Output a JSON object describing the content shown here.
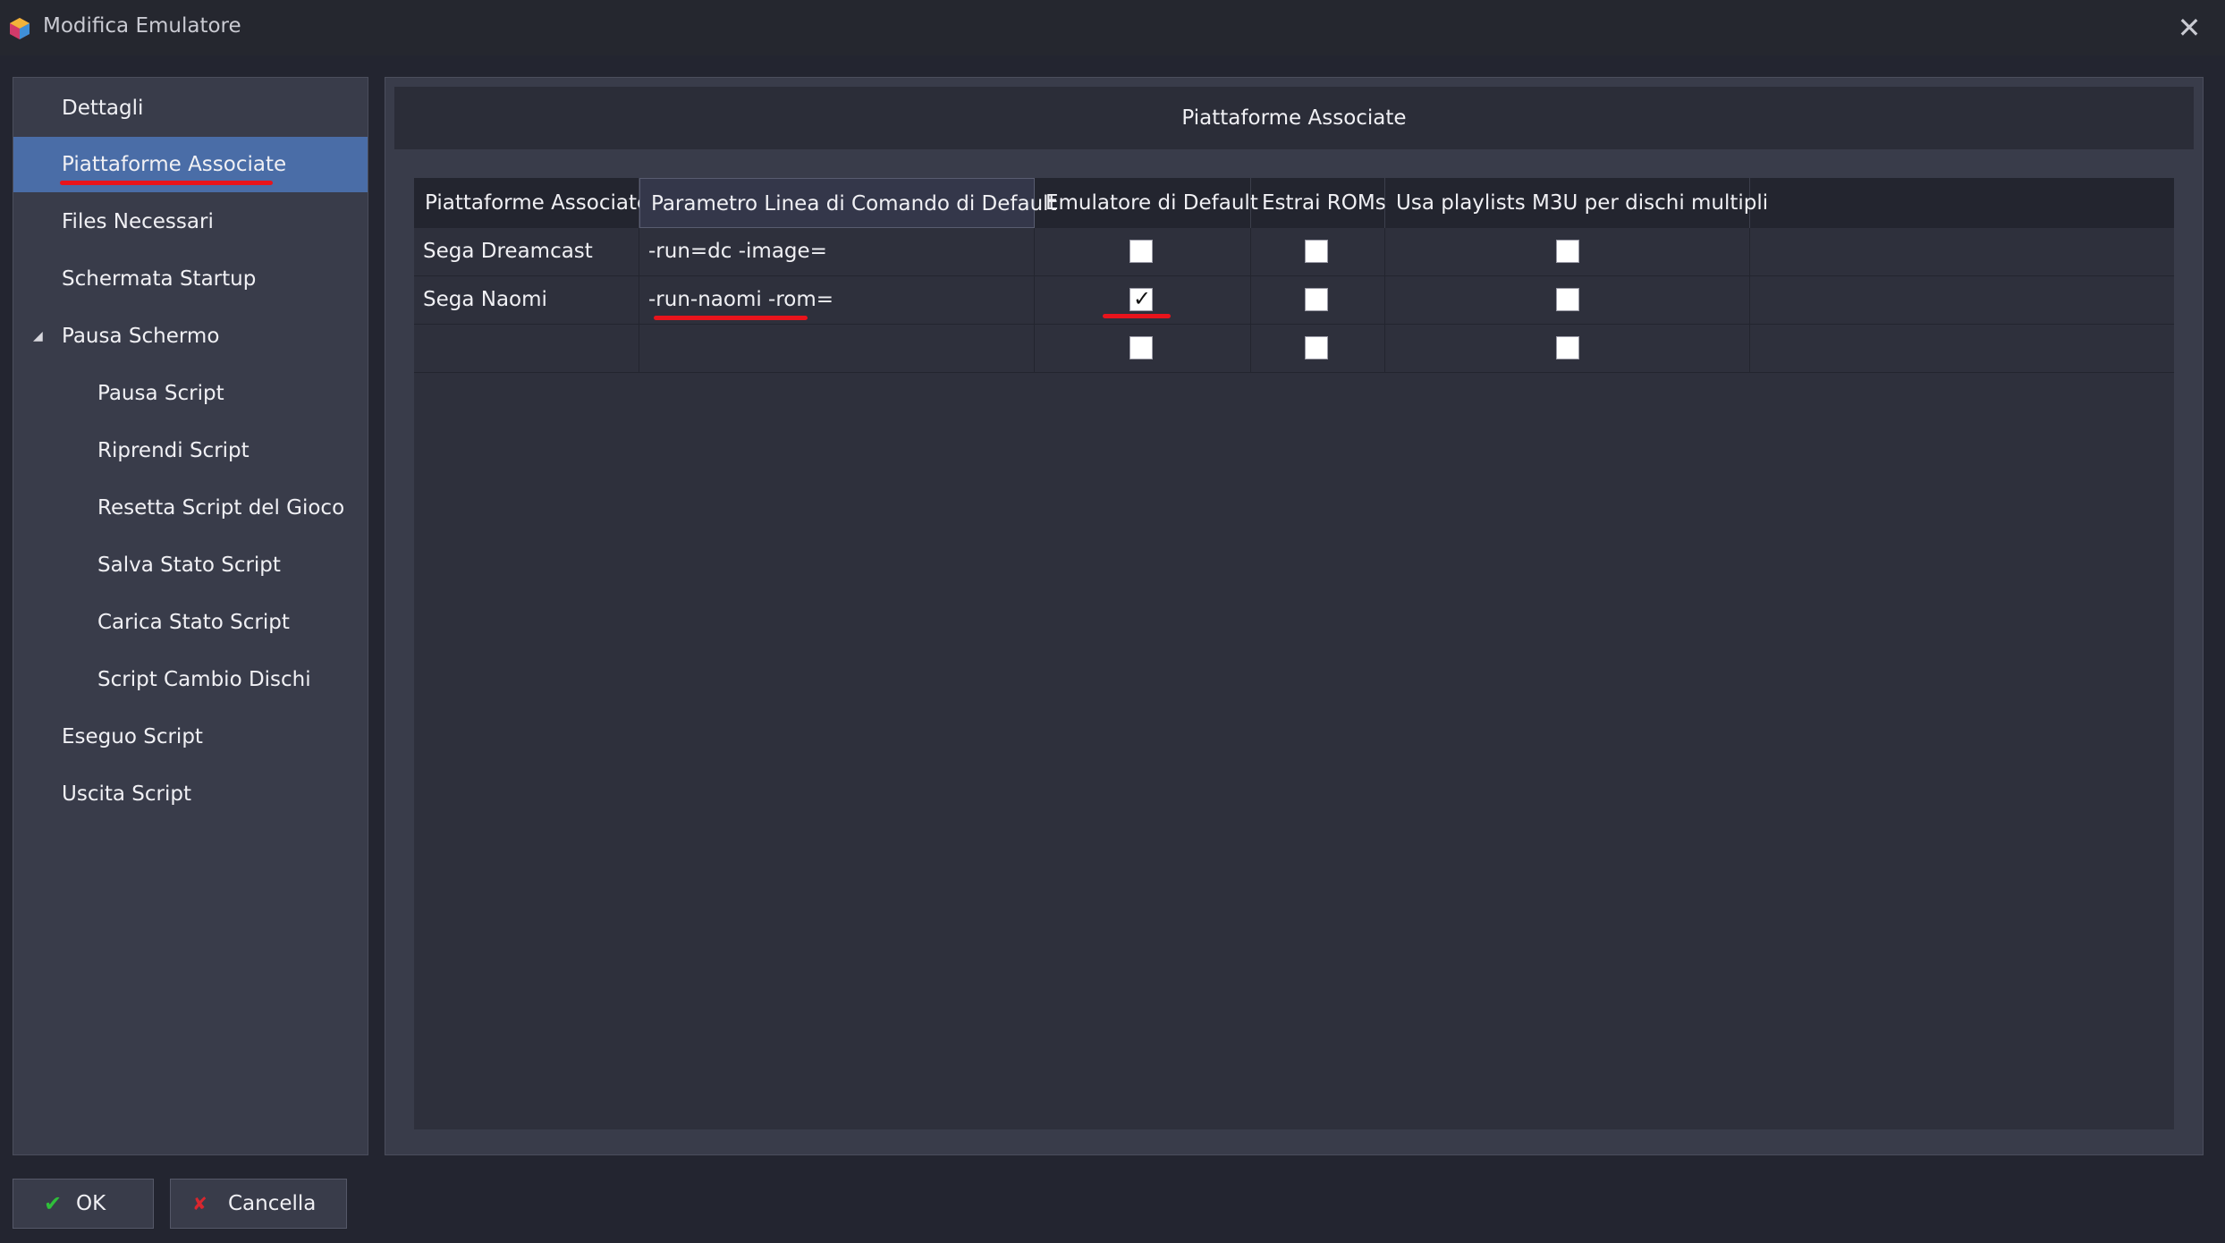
{
  "window": {
    "title": "Modifica Emulatore",
    "close_icon": "close-icon"
  },
  "sidebar": {
    "items": [
      {
        "label": "Dettagli"
      },
      {
        "label": "Piattaforme Associate"
      },
      {
        "label": "Files Necessari"
      },
      {
        "label": "Schermata Startup"
      },
      {
        "label": "Pausa Schermo"
      },
      {
        "label": "Pausa Script"
      },
      {
        "label": "Riprendi Script"
      },
      {
        "label": "Resetta Script del Gioco"
      },
      {
        "label": "Salva Stato Script"
      },
      {
        "label": "Carica Stato Script"
      },
      {
        "label": "Script Cambio Dischi"
      },
      {
        "label": "Eseguo Script"
      },
      {
        "label": "Uscita Script"
      }
    ],
    "selected": "Piattaforme Associate",
    "expanded_group": "Pausa Schermo"
  },
  "panel": {
    "title": "Piattaforme Associate"
  },
  "table": {
    "columns": [
      "Piattaforme Associate",
      "Parametro Linea di Comando di Default",
      "Emulatore di Default",
      "Estrai ROMs",
      "Usa playlists M3U per dischi multipli"
    ],
    "rows": [
      {
        "platform": "Sega Dreamcast",
        "command": "-run=dc -image=",
        "default_emulator": false,
        "extract_roms": false,
        "m3u": false
      },
      {
        "platform": "Sega Naomi",
        "command": "-run-naomi -rom=",
        "default_emulator": true,
        "extract_roms": false,
        "m3u": false
      },
      {
        "platform": "",
        "command": "",
        "default_emulator": false,
        "extract_roms": false,
        "m3u": false
      }
    ]
  },
  "buttons": {
    "ok_label": "OK",
    "cancel_label": "Cancella",
    "ok_icon": "checkmark-icon",
    "cancel_icon": "red-x-icon"
  },
  "colors": {
    "accent_selected": "#4a6da7",
    "annotation_red": "#e8141c",
    "ok_green": "#2fbf3a",
    "cancel_red": "#d8262e"
  }
}
